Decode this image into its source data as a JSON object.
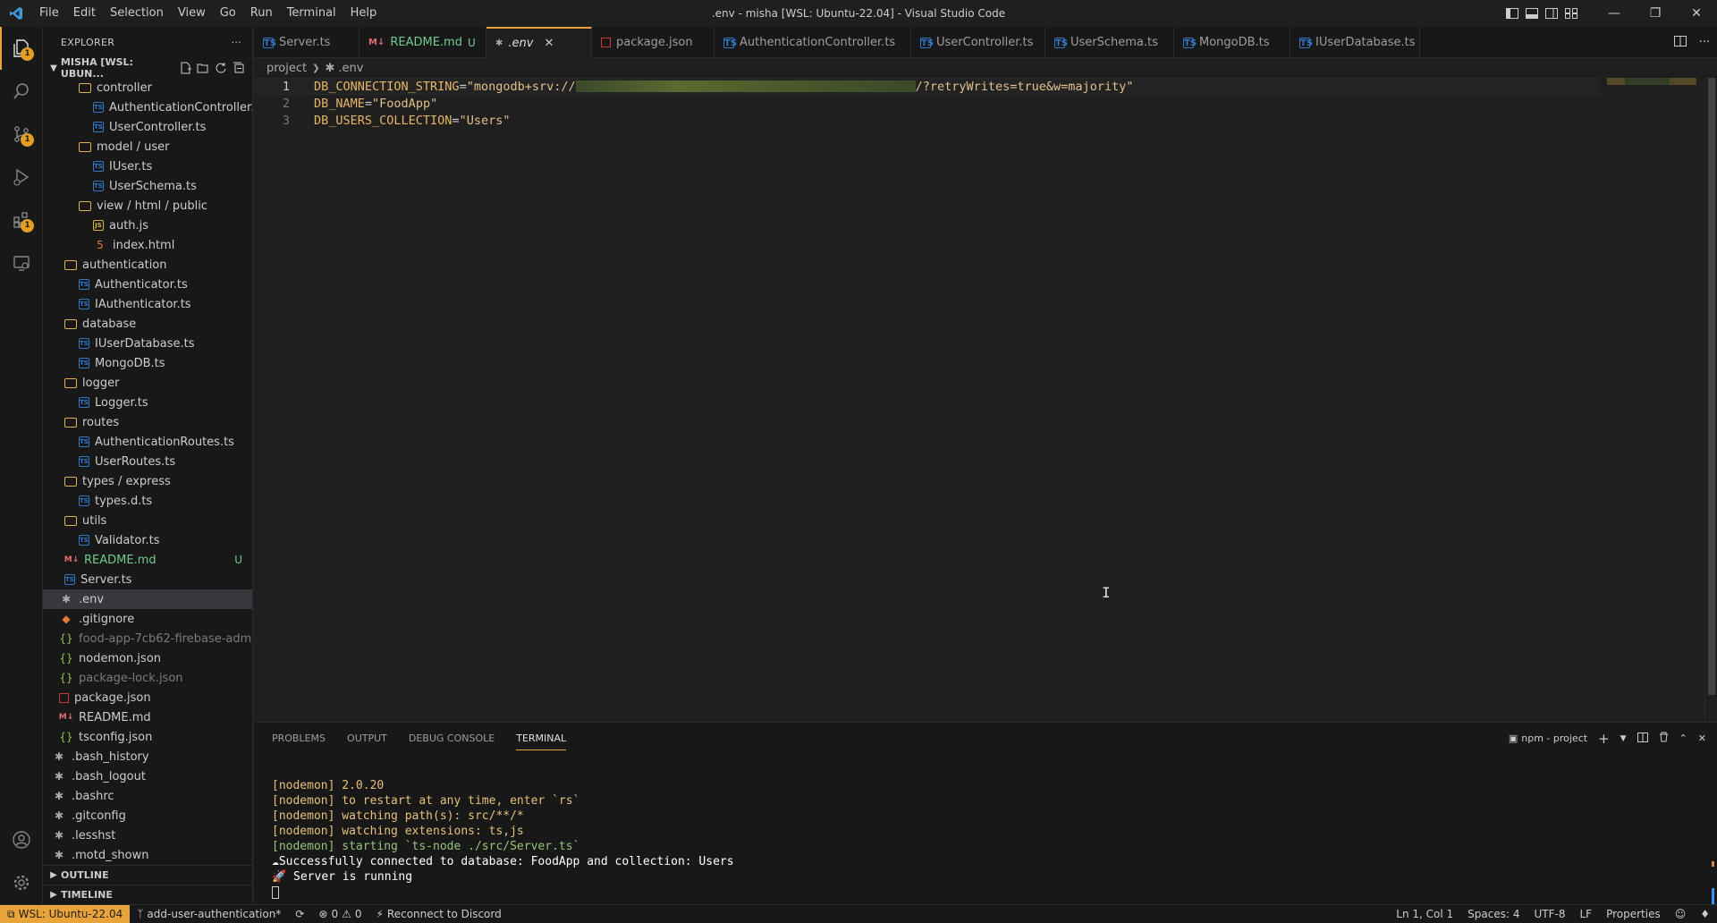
{
  "window": {
    "title": ".env - misha [WSL: Ubuntu-22.04] - Visual Studio Code",
    "menu": [
      "File",
      "Edit",
      "Selection",
      "View",
      "Go",
      "Run",
      "Terminal",
      "Help"
    ]
  },
  "activity_bar": {
    "items": [
      {
        "name": "explorer",
        "icon": "files-icon",
        "badge": "1"
      },
      {
        "name": "search",
        "icon": "search-icon",
        "badge": ""
      },
      {
        "name": "source-control",
        "icon": "source-control-icon",
        "badge": "1"
      },
      {
        "name": "run-debug",
        "icon": "run-debug-icon",
        "badge": ""
      },
      {
        "name": "extensions",
        "icon": "extensions-icon",
        "badge": "1"
      },
      {
        "name": "remote-explorer",
        "icon": "remote-explorer-icon",
        "badge": ""
      }
    ],
    "bottom": [
      "account-icon",
      "settings-gear-icon"
    ]
  },
  "sidebar": {
    "header": "EXPLORER",
    "section": "MISHA [WSL: UBUN...",
    "tree": [
      {
        "label": "controller",
        "type": "folder",
        "indent": 2
      },
      {
        "label": "AuthenticationController.ts",
        "type": "ts",
        "indent": 3
      },
      {
        "label": "UserController.ts",
        "type": "ts",
        "indent": 3
      },
      {
        "label": "model / user",
        "type": "folder",
        "indent": 2
      },
      {
        "label": "IUser.ts",
        "type": "ts",
        "indent": 3
      },
      {
        "label": "UserSchema.ts",
        "type": "ts",
        "indent": 3
      },
      {
        "label": "view / html / public",
        "type": "folder",
        "indent": 2
      },
      {
        "label": "auth.js",
        "type": "js",
        "indent": 3
      },
      {
        "label": "index.html",
        "type": "html",
        "indent": 3
      },
      {
        "label": "authentication",
        "type": "folder",
        "indent": 1
      },
      {
        "label": "Authenticator.ts",
        "type": "ts",
        "indent": 2
      },
      {
        "label": "IAuthenticator.ts",
        "type": "ts",
        "indent": 2
      },
      {
        "label": "database",
        "type": "folder",
        "indent": 1
      },
      {
        "label": "IUserDatabase.ts",
        "type": "ts",
        "indent": 2
      },
      {
        "label": "MongoDB.ts",
        "type": "ts",
        "indent": 2
      },
      {
        "label": "logger",
        "type": "folder",
        "indent": 1
      },
      {
        "label": "Logger.ts",
        "type": "ts",
        "indent": 2
      },
      {
        "label": "routes",
        "type": "folder",
        "indent": 1
      },
      {
        "label": "AuthenticationRoutes.ts",
        "type": "ts",
        "indent": 2
      },
      {
        "label": "UserRoutes.ts",
        "type": "ts",
        "indent": 2
      },
      {
        "label": "types / express",
        "type": "folder",
        "indent": 1
      },
      {
        "label": "types.d.ts",
        "type": "ts",
        "indent": 2
      },
      {
        "label": "utils",
        "type": "folder",
        "indent": 1
      },
      {
        "label": "Validator.ts",
        "type": "ts",
        "indent": 2
      },
      {
        "label": "README.md",
        "type": "md",
        "indent": 1,
        "status": "U",
        "color": "green"
      },
      {
        "label": "Server.ts",
        "type": "ts",
        "indent": 1
      },
      {
        "label": ".env",
        "type": "gear",
        "indent": 0,
        "selected": true
      },
      {
        "label": ".gitignore",
        "type": "git",
        "indent": 0
      },
      {
        "label": "food-app-7cb62-firebase-admi...",
        "type": "json",
        "indent": 0,
        "color": "dim"
      },
      {
        "label": "nodemon.json",
        "type": "json",
        "indent": 0
      },
      {
        "label": "package-lock.json",
        "type": "json",
        "indent": 0,
        "color": "dim"
      },
      {
        "label": "package.json",
        "type": "npm",
        "indent": 0
      },
      {
        "label": "README.md",
        "type": "md",
        "indent": 0
      },
      {
        "label": "tsconfig.json",
        "type": "json",
        "indent": 0
      },
      {
        "label": ".bash_history",
        "type": "gear",
        "indent": -1
      },
      {
        "label": ".bash_logout",
        "type": "gear",
        "indent": -1
      },
      {
        "label": ".bashrc",
        "type": "gear",
        "indent": -1
      },
      {
        "label": ".gitconfig",
        "type": "gear",
        "indent": -1
      },
      {
        "label": ".lesshst",
        "type": "gear",
        "indent": -1
      },
      {
        "label": ".motd_shown",
        "type": "gear",
        "indent": -1
      }
    ],
    "outline": "OUTLINE",
    "timeline": "TIMELINE"
  },
  "tabs": [
    {
      "label": "Server.ts",
      "icon": "TS",
      "active": false
    },
    {
      "label": "README.md",
      "icon": "M↓",
      "active": false,
      "mod": "U",
      "dirty": true
    },
    {
      "label": ".env",
      "icon": "⚙",
      "active": true
    },
    {
      "label": "package.json",
      "icon": "npm",
      "active": false
    },
    {
      "label": "AuthenticationController.ts",
      "icon": "TS",
      "active": false
    },
    {
      "label": "UserController.ts",
      "icon": "TS",
      "active": false
    },
    {
      "label": "UserSchema.ts",
      "icon": "TS",
      "active": false
    },
    {
      "label": "MongoDB.ts",
      "icon": "TS",
      "active": false
    },
    {
      "label": "IUserDatabase.ts",
      "icon": "TS",
      "active": false
    }
  ],
  "breadcrumb": [
    "project",
    ".env"
  ],
  "editor": {
    "lines": [
      {
        "n": "1",
        "key": "DB_CONNECTION_STRING",
        "prefix": "\"mongodb+srv://",
        "suffix": "/?retryWrites=true&w=majority\"",
        "redacted": true
      },
      {
        "n": "2",
        "key": "DB_NAME",
        "value": "\"FoodApp\""
      },
      {
        "n": "3",
        "key": "DB_USERS_COLLECTION",
        "value": "\"Users\""
      }
    ]
  },
  "panel": {
    "tabs": [
      "PROBLEMS",
      "OUTPUT",
      "DEBUG CONSOLE",
      "TERMINAL"
    ],
    "active_tab": "TERMINAL",
    "terminal_name": "npm - project",
    "terminal_lines": [
      "[nodemon] 2.0.20",
      "[nodemon] to restart at any time, enter `rs`",
      "[nodemon] watching path(s): src/**/*",
      "[nodemon] watching extensions: ts,js",
      "[nodemon] starting `ts-node ./src/Server.ts`",
      "☁Successfully connected to database: FoodApp and collection: Users",
      "🚀 Server is running"
    ]
  },
  "statusbar": {
    "remote": "WSL: Ubuntu-22.04",
    "branch": "add-user-authentication*",
    "errors": "0",
    "warnings": "0",
    "discord": "Reconnect to Discord",
    "position": "Ln 1, Col 1",
    "spaces": "Spaces: 4",
    "encoding": "UTF-8",
    "eol": "LF",
    "language": "Properties"
  },
  "colors": {
    "accent": "#e8a33b",
    "background": "#1f1f1f",
    "sidebar": "#181818"
  }
}
